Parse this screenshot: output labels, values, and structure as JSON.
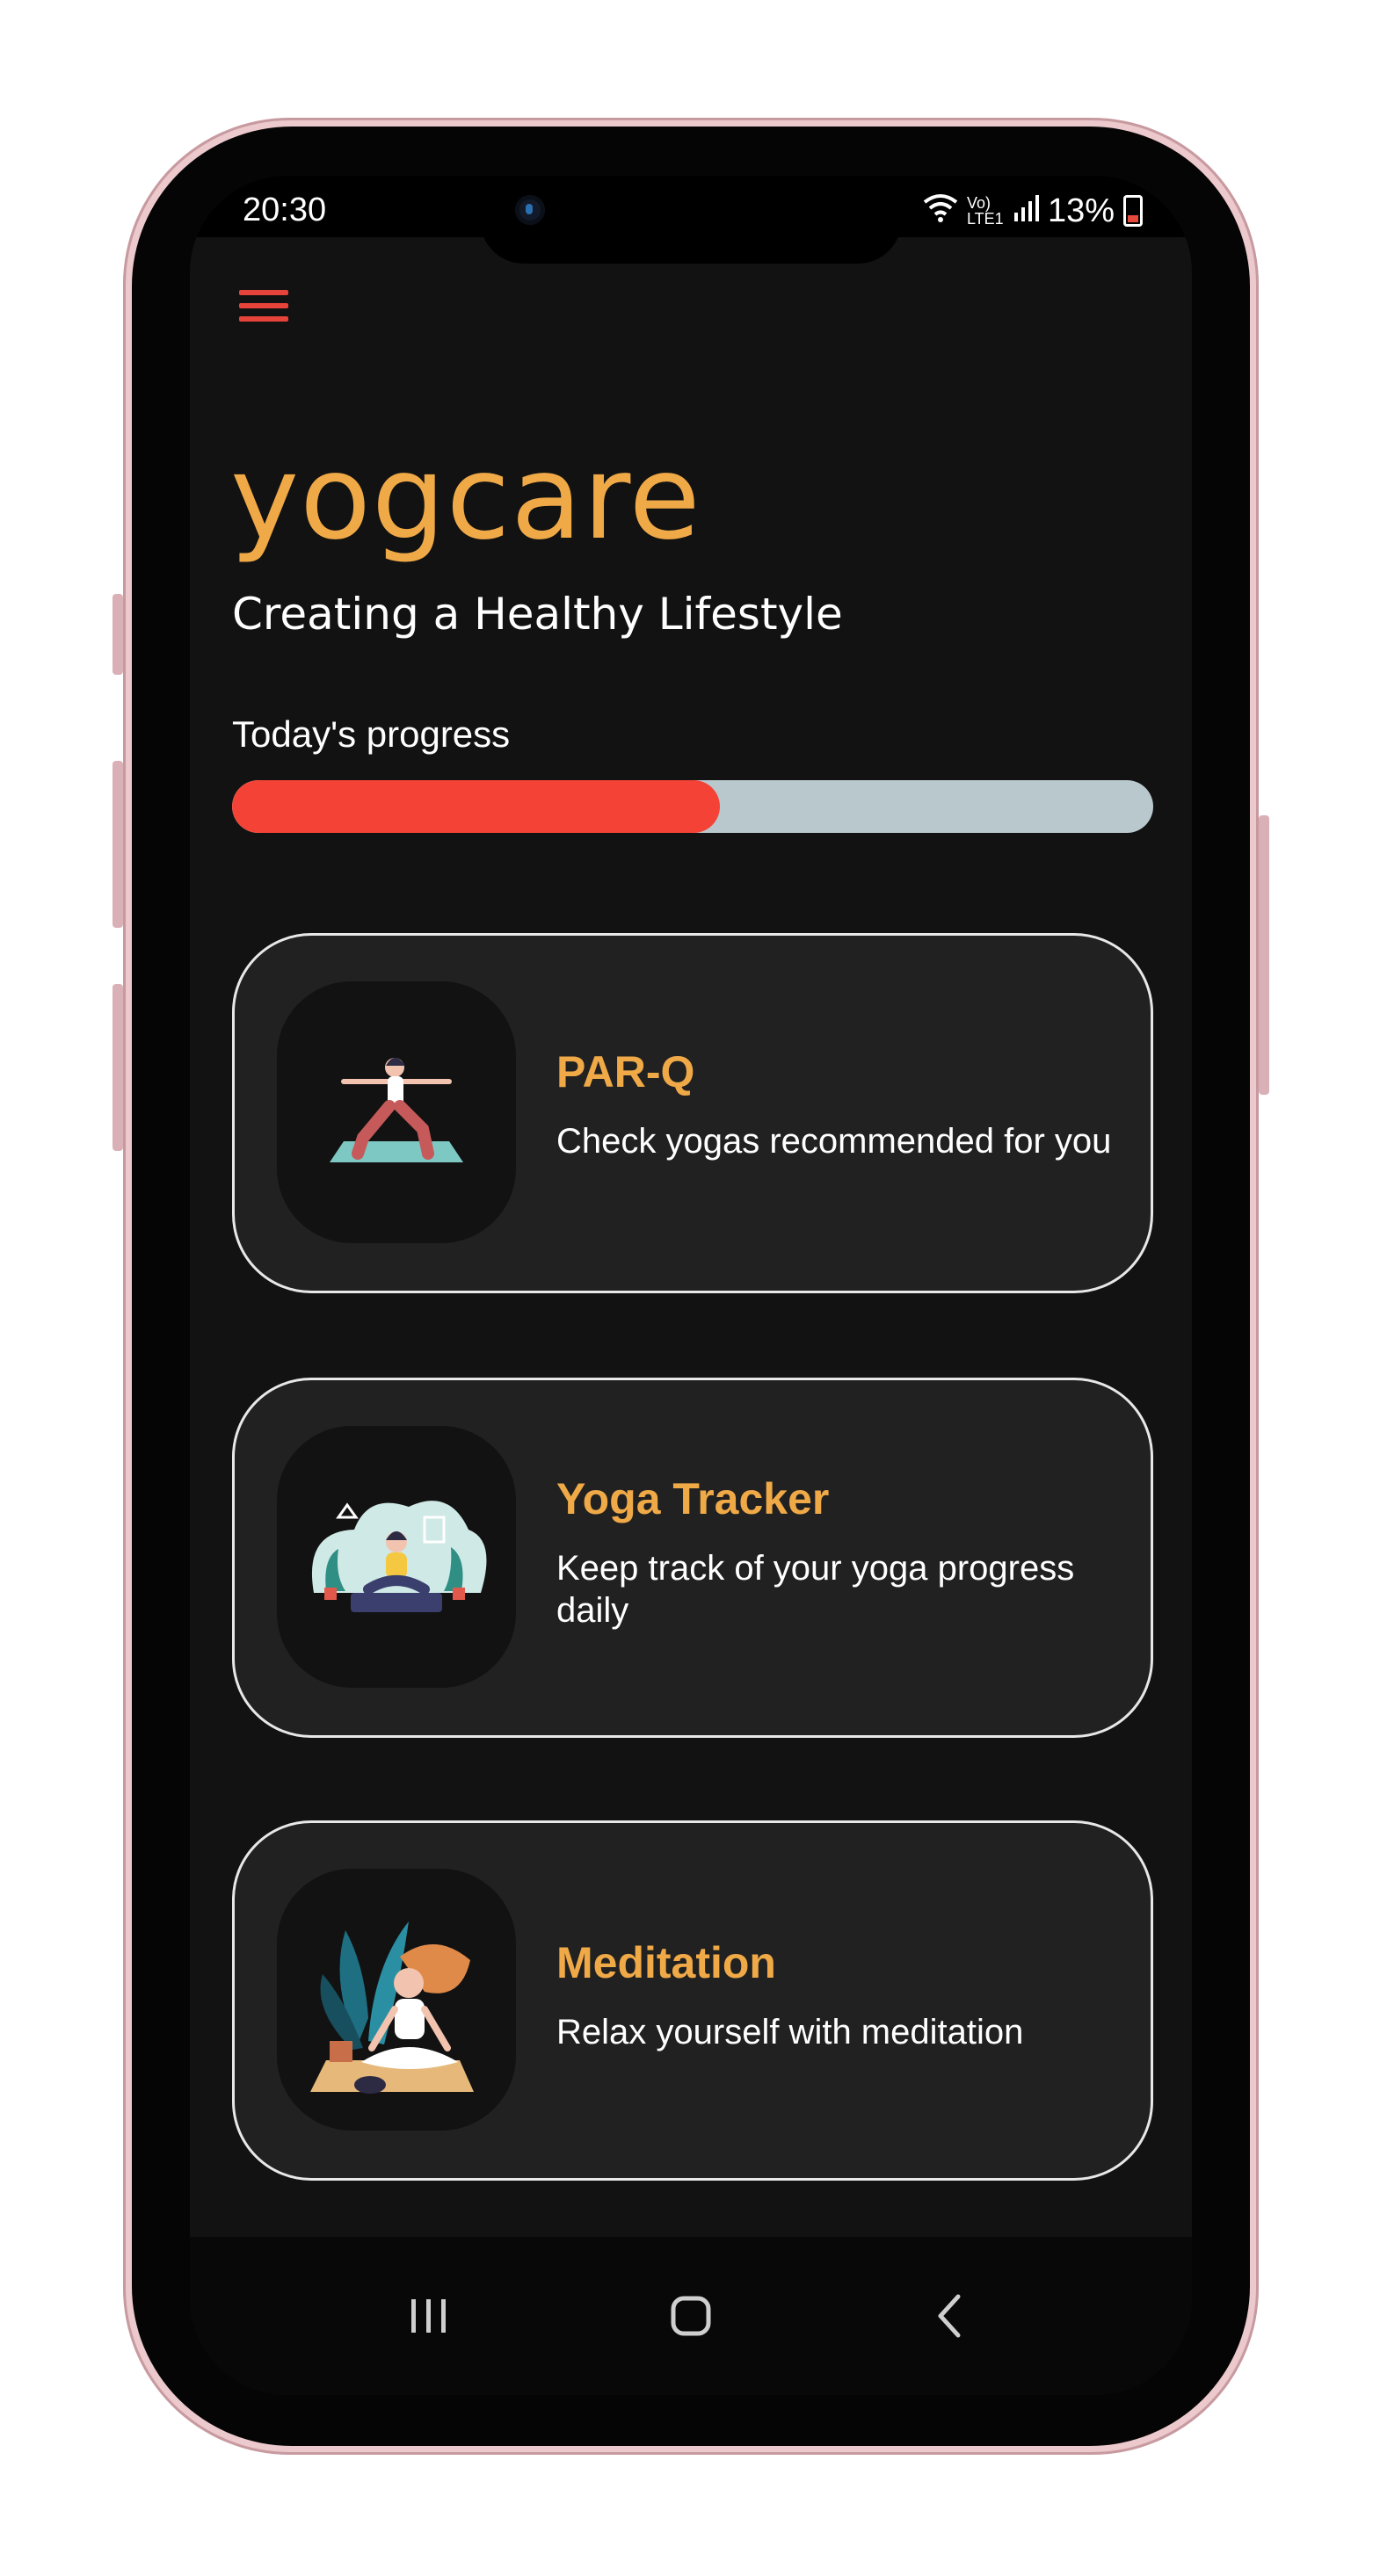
{
  "status_bar": {
    "time": "20:30",
    "network": "Vo) LTE1",
    "battery": "13%"
  },
  "app": {
    "logo": "yogcare",
    "tagline": "Creating a Healthy Lifestyle"
  },
  "progress": {
    "label": "Today's progress",
    "value": 0.53,
    "fill_color": "#f44336",
    "track_color": "#b9c8cd"
  },
  "cards": [
    {
      "title": "PAR-Q",
      "description": "Check yogas recommended for you",
      "image": "yoga-warrior-pose-illustration"
    },
    {
      "title": "Yoga Tracker",
      "description": "Keep track of your yoga progress daily",
      "image": "yoga-plants-illustration"
    },
    {
      "title": "Meditation",
      "description": "Relax yourself with meditation",
      "image": "meditation-illustration"
    }
  ],
  "icons": {
    "menu": "hamburger-menu-icon",
    "nav_recents": "recent-apps-icon",
    "nav_home": "home-icon",
    "nav_back": "back-icon"
  },
  "colors": {
    "accent": "#f0a947",
    "menu": "#e6433a",
    "background": "#121212",
    "card": "#212121"
  }
}
